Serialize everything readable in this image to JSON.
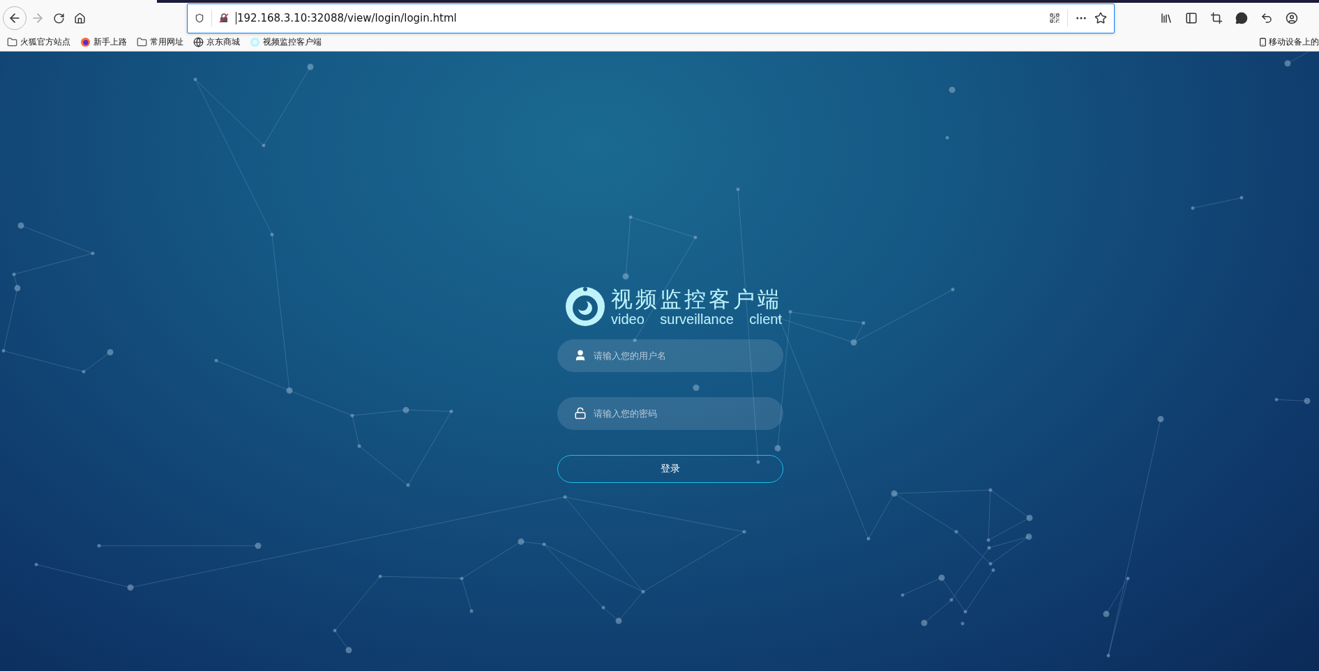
{
  "browser": {
    "url": "192.168.3.10:32088/view/login/login.html"
  },
  "bookmarks": [
    {
      "label": "火狐官方站点",
      "kind": "folder"
    },
    {
      "label": "新手上路",
      "kind": "firefox"
    },
    {
      "label": "常用网址",
      "kind": "folder"
    },
    {
      "label": "京东商城",
      "kind": "globe"
    },
    {
      "label": "视频监控客户端",
      "kind": "app"
    }
  ],
  "mobile_bookmarks": "移动设备上的",
  "login": {
    "title": "视频监控客户端",
    "subtitle": "video surveillance client",
    "fields": [
      {
        "kind": "user",
        "placeholder": "请输入您的用户名"
      },
      {
        "kind": "password",
        "placeholder": "请输入您的密码"
      }
    ],
    "submit": "登录"
  }
}
